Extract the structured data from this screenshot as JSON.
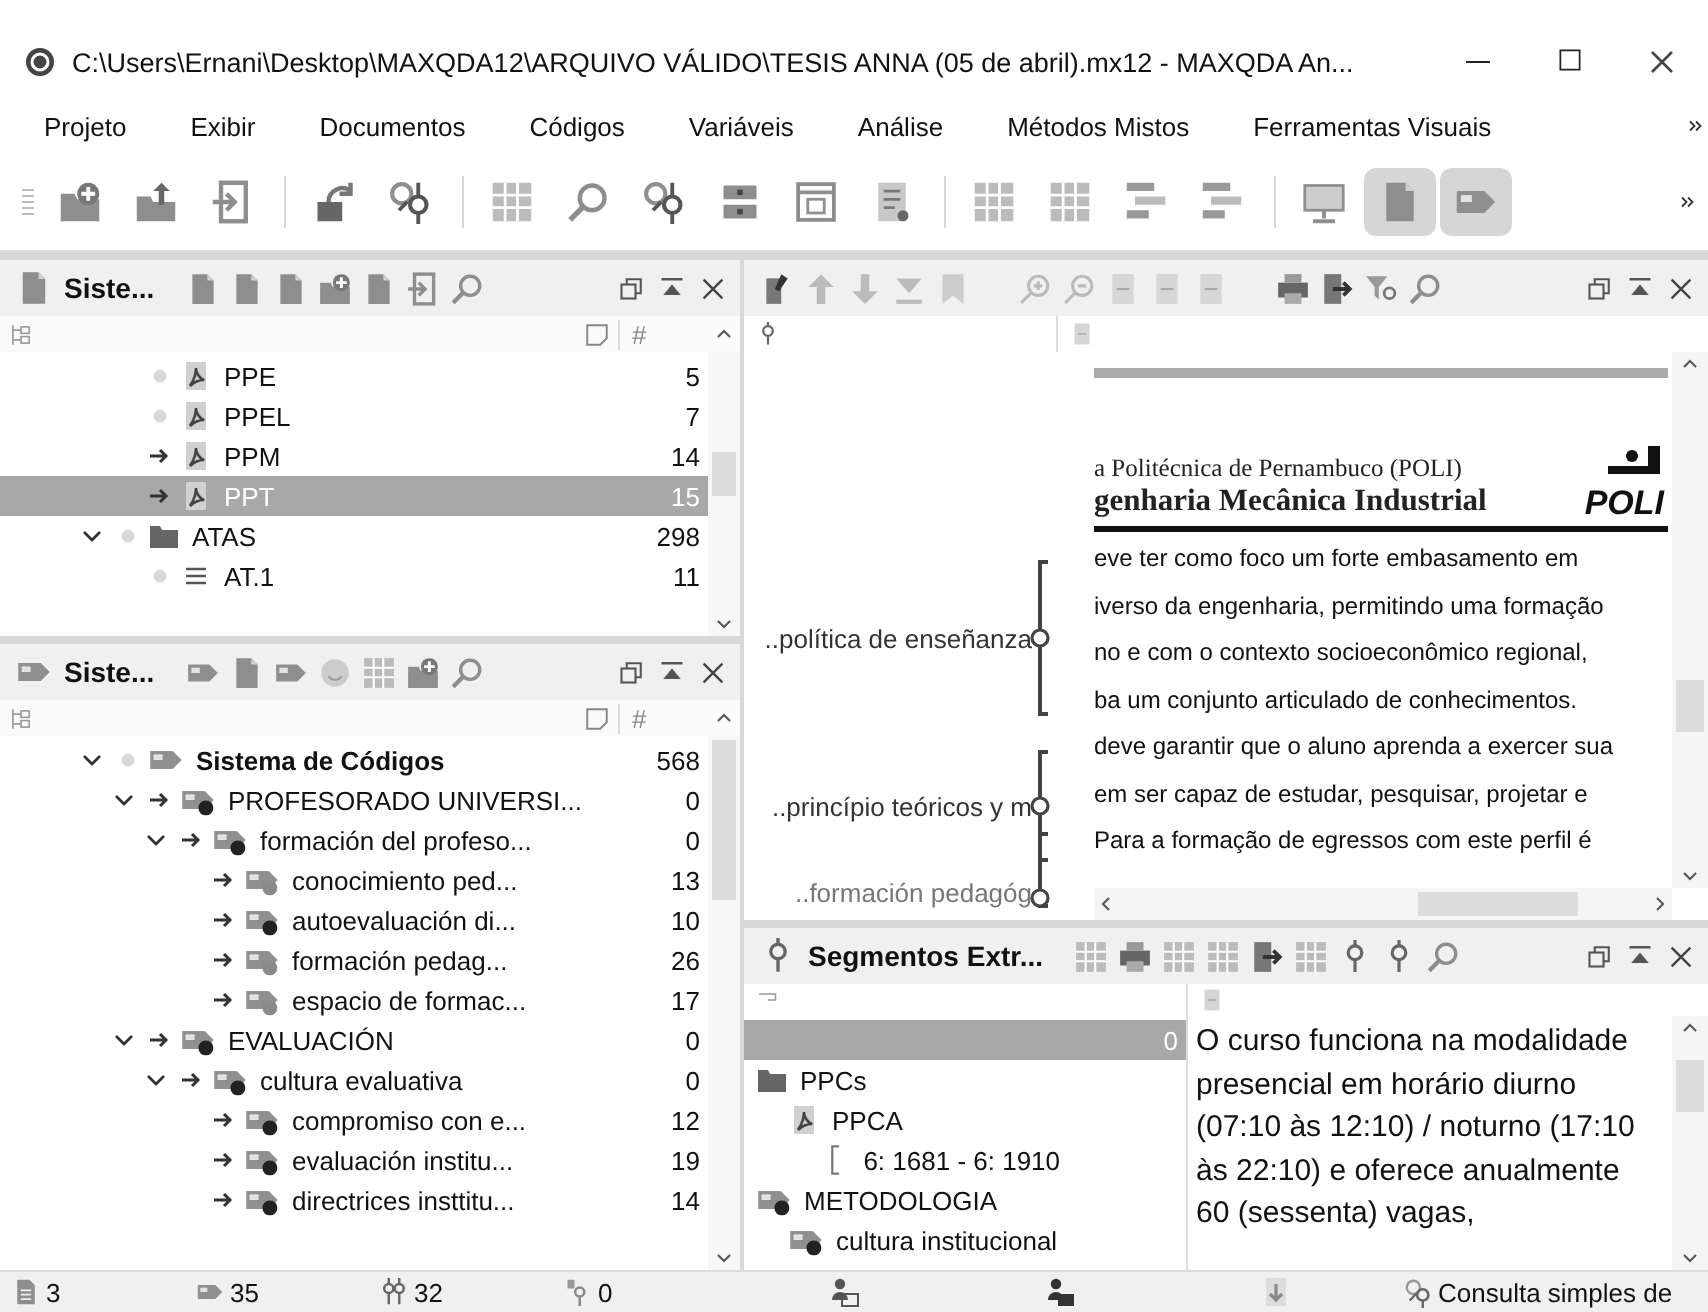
{
  "window": {
    "title": "C:\\Users\\Ernani\\Desktop\\MAXQDA12\\ARQUIVO VÁLIDO\\TESIS ANNA (05 de abril).mx12 - MAXQDA An..."
  },
  "menu": [
    "Projeto",
    "Exibir",
    "Documentos",
    "Códigos",
    "Variáveis",
    "Análise",
    "Métodos Mistos",
    "Ferramentas Visuais"
  ],
  "toolbar": [
    {
      "kind": "folder-plus",
      "pressed": false
    },
    {
      "kind": "folder-up",
      "pressed": false
    },
    {
      "kind": "exit",
      "pressed": false
    },
    {
      "kind": "undo",
      "pressed": false
    },
    {
      "kind": "pin-search",
      "pressed": false
    },
    {
      "kind": "table",
      "pressed": false
    },
    {
      "kind": "search",
      "pressed": false
    },
    {
      "kind": "pin-search",
      "pressed": false
    },
    {
      "kind": "columns",
      "pressed": false
    },
    {
      "kind": "window",
      "pressed": false
    },
    {
      "kind": "notes",
      "pressed": false
    },
    {
      "kind": "table",
      "pressed": false
    },
    {
      "kind": "table",
      "pressed": false
    },
    {
      "kind": "list",
      "pressed": false
    },
    {
      "kind": "list",
      "pressed": false
    },
    {
      "kind": "monitor",
      "pressed": false
    },
    {
      "kind": "document",
      "pressed": true
    },
    {
      "kind": "tag",
      "pressed": true
    }
  ],
  "document_system": {
    "title": "Siste...",
    "count_header": "#",
    "scrolled_group_children": [
      {
        "label": "PPE",
        "kind": "pdf",
        "activated": false,
        "count": "5",
        "selected": false
      },
      {
        "label": "PPEL",
        "kind": "pdf",
        "activated": false,
        "count": "7",
        "selected": false
      },
      {
        "label": "PPM",
        "kind": "pdf",
        "activated": true,
        "count": "14",
        "selected": false
      },
      {
        "label": "PPT",
        "kind": "pdf",
        "activated": true,
        "count": "15",
        "selected": true
      }
    ],
    "items": [
      {
        "label": "ATAS",
        "kind": "folder",
        "activated": false,
        "expanded": true,
        "count": "298",
        "selected": false,
        "children": [
          {
            "label": "AT.1",
            "kind": "text",
            "activated": false,
            "count": "11",
            "selected": false
          }
        ]
      }
    ]
  },
  "code_system": {
    "title": "Siste...",
    "count_header": "#",
    "items": [
      {
        "label": "Sistema de Códigos",
        "kind": "root",
        "activated": false,
        "expanded": true,
        "count": "568",
        "children": [
          {
            "label": "PROFESORADO UNIVERSI...",
            "kind": "code",
            "color": "#222222",
            "activated": true,
            "expanded": true,
            "count": "0",
            "children": [
              {
                "label": "formación del profeso...",
                "kind": "code",
                "color": "#222222",
                "activated": true,
                "expanded": true,
                "count": "0",
                "children": [
                  {
                    "label": "conocimiento ped...",
                    "kind": "code",
                    "color": "#8a8a8a",
                    "activated": true,
                    "count": "13"
                  },
                  {
                    "label": "autoevaluación di...",
                    "kind": "code",
                    "color": "#222222",
                    "activated": true,
                    "count": "10"
                  },
                  {
                    "label": "formación pedag...",
                    "kind": "code",
                    "color": "#8a8a8a",
                    "activated": true,
                    "count": "26"
                  },
                  {
                    "label": "espacio de formac...",
                    "kind": "code",
                    "color": "#8a8a8a",
                    "activated": true,
                    "count": "17"
                  }
                ]
              }
            ]
          },
          {
            "label": "EVALUACIÓN",
            "kind": "code",
            "color": "#222222",
            "activated": true,
            "expanded": true,
            "count": "0",
            "children": [
              {
                "label": "cultura evaluativa",
                "kind": "code",
                "color": "#222222",
                "activated": true,
                "expanded": true,
                "count": "0",
                "children": [
                  {
                    "label": "compromiso con e...",
                    "kind": "code",
                    "color": "#222222",
                    "activated": true,
                    "count": "12"
                  },
                  {
                    "label": "evaluación institu...",
                    "kind": "code",
                    "color": "#222222",
                    "activated": true,
                    "count": "19"
                  },
                  {
                    "label": "directrices insttitu...",
                    "kind": "code",
                    "color": "#222222",
                    "activated": true,
                    "count": "14"
                  }
                ]
              }
            ]
          }
        ]
      }
    ]
  },
  "document_browser": {
    "margin_codes": [
      {
        "label": "..política de enseñanza"
      },
      {
        "label": "..princípio teóricos y m"
      },
      {
        "label": "..formación pedagóg"
      }
    ],
    "page": {
      "header_lines": [
        "a Politécnica de Pernambuco (POLI)",
        "genharia Mecânica Industrial"
      ],
      "logo": "POLI",
      "lines": [
        "eve ter como foco um forte embasamento em",
        "iverso da engenharia, permitindo uma formação",
        "no e com o contexto socioeconômico regional,",
        "ba um conjunto articulado de conhecimentos.",
        "deve garantir que o aluno aprenda a exercer sua",
        "em ser capaz de estudar, pesquisar, projetar e",
        "Para a formação de egressos com este perfil é"
      ]
    }
  },
  "retrieved_segments": {
    "title": "Segmentos Extr...",
    "items": [
      {
        "kind": "summary",
        "count": "0",
        "selected": true
      },
      {
        "label": "PPCs",
        "kind": "folder",
        "selected": false,
        "children": [
          {
            "label": "PPCA",
            "kind": "pdf",
            "selected": false,
            "children": [
              {
                "label": "6: 1681 - 6: 1910",
                "kind": "segment",
                "selected": false
              }
            ]
          }
        ]
      },
      {
        "label": "METODOLOGIA",
        "kind": "code",
        "color": "#222222",
        "selected": false,
        "children": [
          {
            "label": "cultura institucional",
            "kind": "code",
            "color": "#222222",
            "selected": false
          }
        ]
      }
    ],
    "segment_text": "O curso funciona na modalidade presencial em horário diurno (07:10 às 12:10) / noturno (17:10 às 22:10) e oferece anualmente 60 (sessenta) vagas,"
  },
  "status_bar": {
    "counts": [
      {
        "kind": "documents",
        "value": "3"
      },
      {
        "kind": "codes",
        "value": "35"
      },
      {
        "kind": "segments",
        "value": "32"
      },
      {
        "kind": "memos",
        "value": "0"
      }
    ],
    "query": "Consulta simples de"
  }
}
